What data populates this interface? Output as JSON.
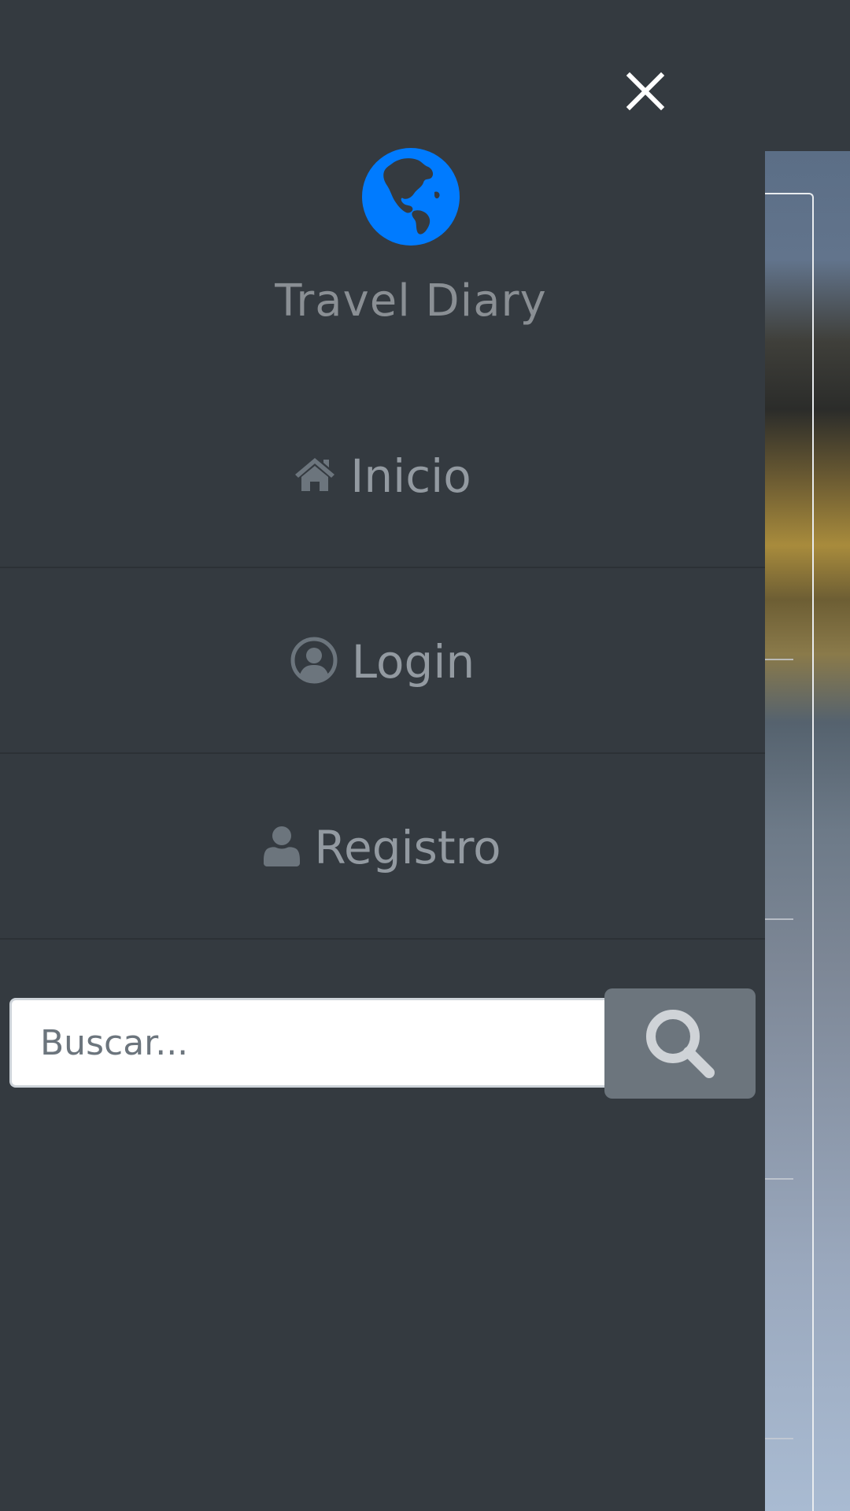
{
  "brand": {
    "title": "Travel Diary",
    "color": "#007bff"
  },
  "nav": [
    {
      "label": "Inicio",
      "icon": "home-icon"
    },
    {
      "label": "Login",
      "icon": "user-circle-icon"
    },
    {
      "label": "Registro",
      "icon": "user-icon"
    }
  ],
  "search": {
    "placeholder": "Buscar...",
    "value": "",
    "button_icon": "search-icon"
  },
  "close": {
    "icon": "close-icon"
  },
  "colors": {
    "sidebar_bg": "#343a40",
    "text_muted": "#939aa1",
    "button_bg": "#6c757d"
  }
}
